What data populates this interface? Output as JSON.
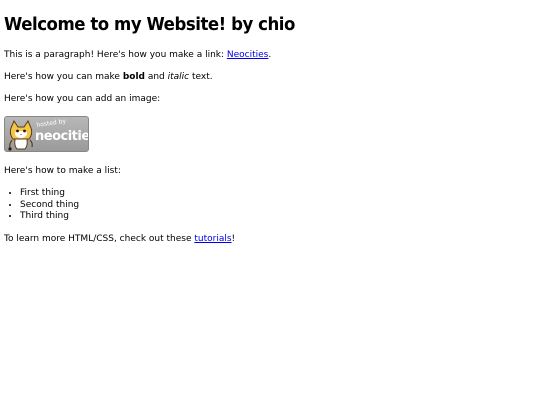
{
  "heading": "Welcome to my Website! by chio",
  "paragraph_link": {
    "before": "This is a paragraph! Here's how you make a link: ",
    "link_text": "Neocities",
    "after": "."
  },
  "paragraph_format": {
    "before": "Here's how you can make ",
    "bold": "bold",
    "middle": " and ",
    "italic": "italic",
    "after": " text."
  },
  "paragraph_image": "Here's how you can add an image:",
  "badge": {
    "hosted_text": "hosted by",
    "name_text": "neocities",
    "icon": "neocities-cat-icon"
  },
  "paragraph_list": "Here's how to make a list:",
  "list_items": [
    "First thing",
    "Second thing",
    "Third thing"
  ],
  "paragraph_learn": {
    "before": "To learn more HTML/CSS, check out these ",
    "link_text": "tutorials",
    "after": "!"
  },
  "colors": {
    "link": "#0000ee",
    "badge_background": "#a8a8a8"
  }
}
